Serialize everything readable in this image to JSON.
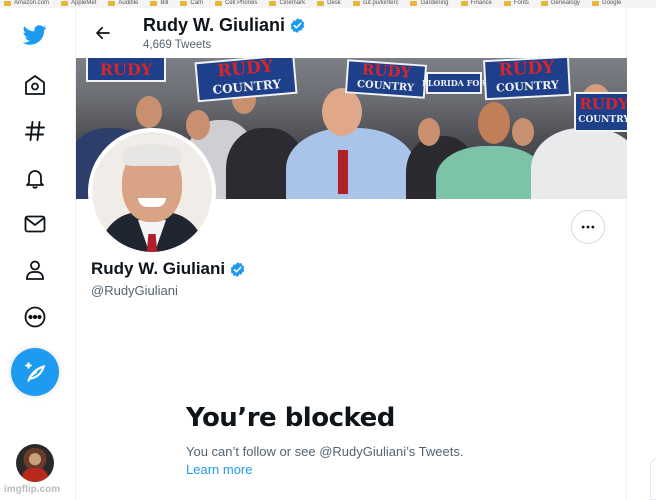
{
  "bookmarks": [
    "Amazon.com",
    "AppleMet",
    "Audible",
    "Bill",
    "Cam",
    "Cell Phones",
    "Cinemark",
    "Desk",
    "cut.pu/kinterc",
    "Gardening",
    "Finance",
    "Fonts",
    "Genealogy",
    "Google"
  ],
  "header": {
    "name": "Rudy W. Giuliani",
    "tweet_count": "4,669 Tweets"
  },
  "banner": {
    "sign_rudy": "RUDY",
    "sign_country": "COUNTRY",
    "sign_florida": "FLORIDA",
    "sign_for": "FOR"
  },
  "profile": {
    "name": "Rudy W. Giuliani",
    "handle": "@RudyGiuliani"
  },
  "blocked": {
    "title": "You’re blocked",
    "message": "You can’t follow or see @RudyGiuliani’s Tweets.",
    "link": "Learn more"
  },
  "watermark": "imgflip.com",
  "colors": {
    "accent": "#1d9bf0",
    "text": "#0f1419",
    "secondary_text": "#536471"
  },
  "icons": {
    "logo": "twitter-bird-icon",
    "home": "home-icon",
    "explore": "hashtag-icon",
    "notifications": "bell-icon",
    "messages": "envelope-icon",
    "profile": "person-icon",
    "more": "more-circle-icon",
    "compose": "compose-feather-icon",
    "back": "arrow-left-icon",
    "verified": "verified-badge-icon"
  }
}
